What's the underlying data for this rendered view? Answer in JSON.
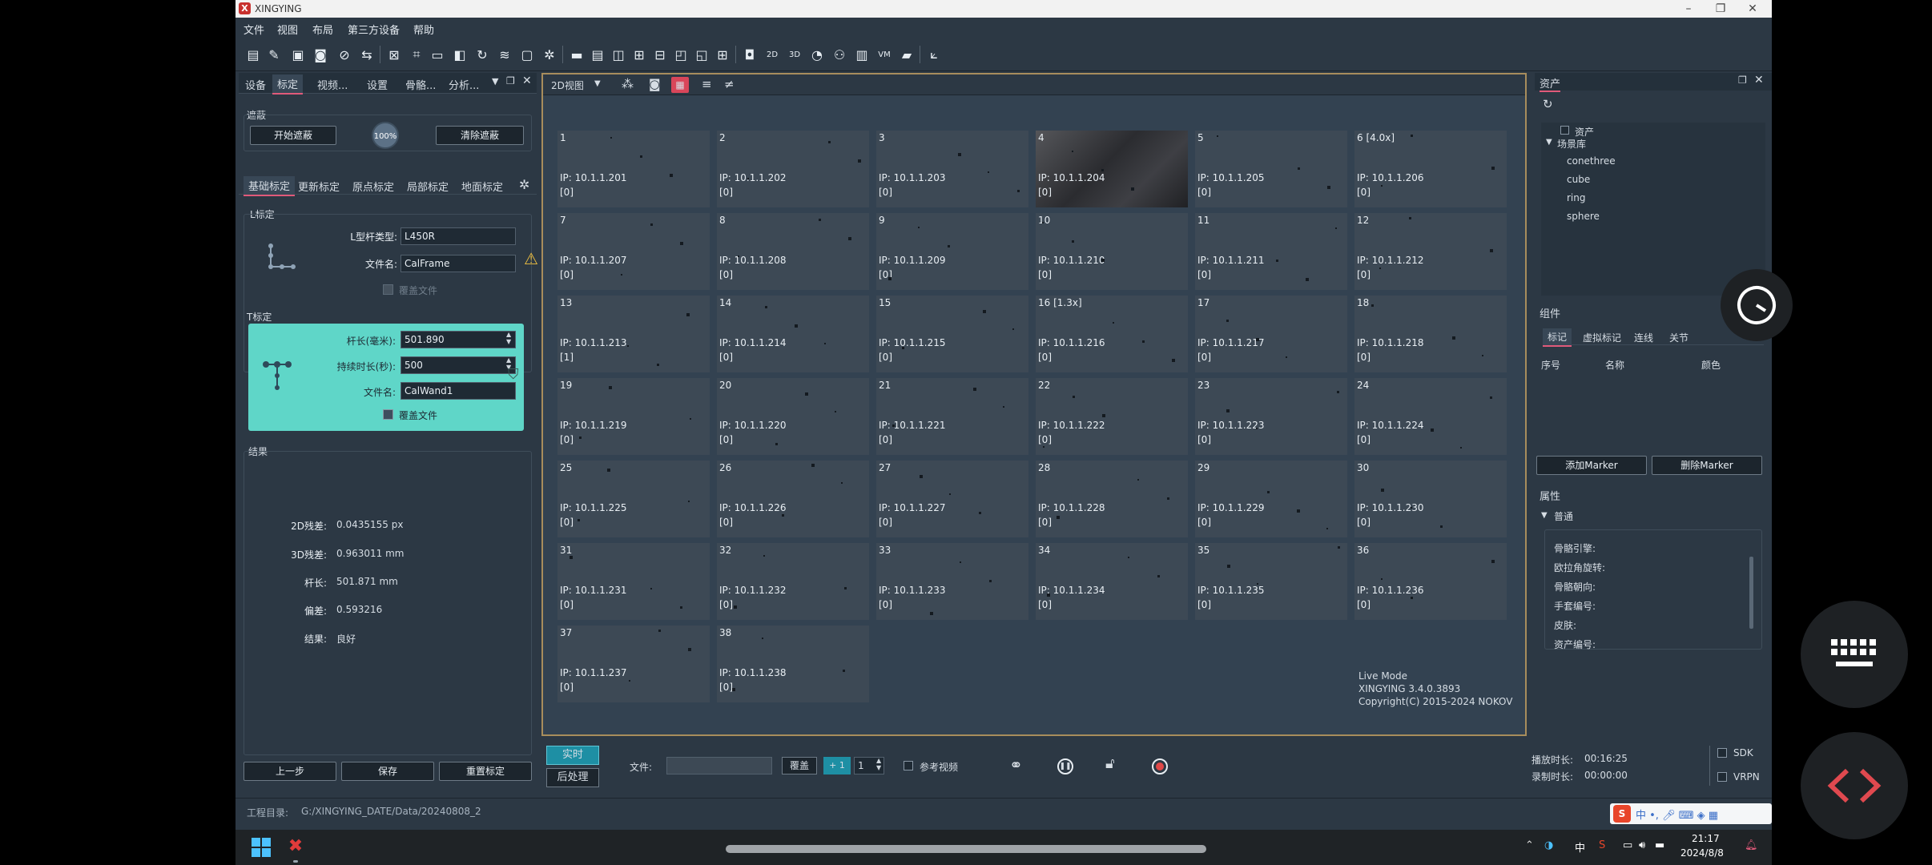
{
  "window": {
    "title": "XINGYING"
  },
  "menu": [
    "文件",
    "视图",
    "布局",
    "第三方设备",
    "帮助"
  ],
  "left_tabs": [
    "设备",
    "标定",
    "视频...",
    "设置",
    "骨骼...",
    "分析..."
  ],
  "mask": {
    "title": "遮蔽",
    "start": "开始遮蔽",
    "percent": "100%",
    "clear": "清除遮蔽"
  },
  "sub_tabs": [
    "基础标定",
    "更新标定",
    "原点标定",
    "局部标定",
    "地面标定"
  ],
  "l_calib": {
    "title": "L标定",
    "type_label": "L型杆类型:",
    "type_value": "L450R",
    "file_label": "文件名:",
    "file_value": "CalFrame",
    "overwrite": "覆盖文件"
  },
  "t_calib": {
    "title": "T标定",
    "len_label": "杆长(毫米):",
    "len_value": "501.890",
    "dur_label": "持续时长(秒):",
    "dur_value": "500",
    "file_label": "文件名:",
    "file_value": "CalWand1",
    "overwrite": "覆盖文件"
  },
  "results": {
    "title": "结果",
    "rows": [
      {
        "label": "2D残差:",
        "value": "0.0435155 px"
      },
      {
        "label": "3D残差:",
        "value": "0.963011 mm"
      },
      {
        "label": "杆长:",
        "value": "501.871 mm"
      },
      {
        "label": "偏差:",
        "value": "0.593216"
      },
      {
        "label": "结果:",
        "value": "良好"
      }
    ]
  },
  "left_buttons": {
    "prev": "上一步",
    "save": "保存",
    "reset": "重置标定"
  },
  "view": {
    "mode": "2D视图"
  },
  "cameras": [
    {
      "n": "1",
      "ip": "IP: 10.1.1.201",
      "c": "[0]"
    },
    {
      "n": "2",
      "ip": "IP: 10.1.1.202",
      "c": "[0]"
    },
    {
      "n": "3",
      "ip": "IP: 10.1.1.203",
      "c": "[0]"
    },
    {
      "n": "4",
      "ip": "IP: 10.1.1.204",
      "c": "[0]"
    },
    {
      "n": "5",
      "ip": "IP: 10.1.1.205",
      "c": "[0]"
    },
    {
      "n": "6 [4.0x]",
      "ip": "IP: 10.1.1.206",
      "c": "[0]"
    },
    {
      "n": "7",
      "ip": "IP: 10.1.1.207",
      "c": "[0]"
    },
    {
      "n": "8",
      "ip": "IP: 10.1.1.208",
      "c": "[0]"
    },
    {
      "n": "9",
      "ip": "IP: 10.1.1.209",
      "c": "[0]"
    },
    {
      "n": "10",
      "ip": "IP: 10.1.1.210",
      "c": "[0]"
    },
    {
      "n": "11",
      "ip": "IP: 10.1.1.211",
      "c": "[0]"
    },
    {
      "n": "12",
      "ip": "IP: 10.1.1.212",
      "c": "[0]"
    },
    {
      "n": "13",
      "ip": "IP: 10.1.1.213",
      "c": "[1]"
    },
    {
      "n": "14",
      "ip": "IP: 10.1.1.214",
      "c": "[0]"
    },
    {
      "n": "15",
      "ip": "IP: 10.1.1.215",
      "c": "[0]"
    },
    {
      "n": "16 [1.3x]",
      "ip": "IP: 10.1.1.216",
      "c": "[0]"
    },
    {
      "n": "17",
      "ip": "IP: 10.1.1.217",
      "c": "[0]"
    },
    {
      "n": "18",
      "ip": "IP: 10.1.1.218",
      "c": "[0]"
    },
    {
      "n": "19",
      "ip": "IP: 10.1.1.219",
      "c": "[0]"
    },
    {
      "n": "20",
      "ip": "IP: 10.1.1.220",
      "c": "[0]"
    },
    {
      "n": "21",
      "ip": "IP: 10.1.1.221",
      "c": "[0]"
    },
    {
      "n": "22",
      "ip": "IP: 10.1.1.222",
      "c": "[0]"
    },
    {
      "n": "23",
      "ip": "IP: 10.1.1.223",
      "c": "[0]"
    },
    {
      "n": "24",
      "ip": "IP: 10.1.1.224",
      "c": "[0]"
    },
    {
      "n": "25",
      "ip": "IP: 10.1.1.225",
      "c": "[0]"
    },
    {
      "n": "26",
      "ip": "IP: 10.1.1.226",
      "c": "[0]"
    },
    {
      "n": "27",
      "ip": "IP: 10.1.1.227",
      "c": "[0]"
    },
    {
      "n": "28",
      "ip": "IP: 10.1.1.228",
      "c": "[0]"
    },
    {
      "n": "29",
      "ip": "IP: 10.1.1.229",
      "c": "[0]"
    },
    {
      "n": "30",
      "ip": "IP: 10.1.1.230",
      "c": "[0]"
    },
    {
      "n": "31",
      "ip": "IP: 10.1.1.231",
      "c": "[0]"
    },
    {
      "n": "32",
      "ip": "IP: 10.1.1.232",
      "c": "[0]"
    },
    {
      "n": "33",
      "ip": "IP: 10.1.1.233",
      "c": "[0]"
    },
    {
      "n": "34",
      "ip": "IP: 10.1.1.234",
      "c": "[0]"
    },
    {
      "n": "35",
      "ip": "IP: 10.1.1.235",
      "c": "[0]"
    },
    {
      "n": "36",
      "ip": "IP: 10.1.1.236",
      "c": "[0]"
    },
    {
      "n": "37",
      "ip": "IP: 10.1.1.237",
      "c": "[0]"
    },
    {
      "n": "38",
      "ip": "IP: 10.1.1.238",
      "c": "[0]"
    }
  ],
  "info": {
    "mode": "Live Mode",
    "version": "XINGYING 3.4.0.3893",
    "copyright": "Copyright(C) 2015-2024 NOKOV"
  },
  "assets": {
    "title": "资产",
    "root": "资产",
    "scene": "场景库",
    "items": [
      "conethree",
      "cube",
      "ring",
      "sphere"
    ]
  },
  "components": {
    "title": "组件",
    "tabs": [
      "标记",
      "虚拟标记",
      "连线",
      "关节"
    ],
    "cols": [
      "序号",
      "名称",
      "颜色"
    ],
    "add": "添加Marker",
    "del": "删除Marker"
  },
  "props": {
    "title": "属性",
    "group": "普通",
    "rows": [
      "骨骼引擎:",
      "欧拉角旋转:",
      "骨骼朝向:",
      "手套编号:",
      "皮肤:",
      "资产编号:"
    ]
  },
  "bottom": {
    "realtime": "实时",
    "post": "后处理",
    "file_label": "文件:",
    "overwrite": "覆盖",
    "plus": "+ 1",
    "num": "1",
    "ref_video": "参考视频",
    "play_label": "播放时长:",
    "play_value": "00:16:25",
    "rec_label": "录制时长:",
    "rec_value": "00:00:00",
    "sdk": "SDK",
    "vrpn": "VRPN"
  },
  "status": {
    "path_label": "工程目录:",
    "path": "G:/XINGYING_DATE/Data/20240808_2"
  },
  "taskbar": {
    "time": "21:17",
    "date": "2024/8/8",
    "ime": "中"
  }
}
